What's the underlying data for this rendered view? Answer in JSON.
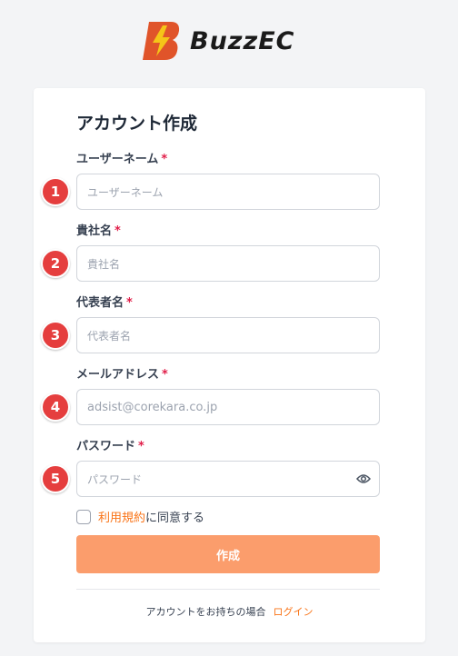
{
  "brand": {
    "name": "BuzzEC",
    "logo_color": "#e0542a",
    "bolt_color": "#f5c518"
  },
  "form": {
    "title": "アカウント作成",
    "required_mark": "*",
    "fields": [
      {
        "label": "ユーザーネーム",
        "placeholder": "ユーザーネーム",
        "badge": "1"
      },
      {
        "label": "貴社名",
        "placeholder": "貴社名",
        "badge": "2"
      },
      {
        "label": "代表者名",
        "placeholder": "代表者名",
        "badge": "3"
      },
      {
        "label": "メールアドレス",
        "placeholder": "adsist@corekara.co.jp",
        "badge": "4"
      },
      {
        "label": "パスワード",
        "placeholder": "パスワード",
        "badge": "5",
        "icon": "eye-icon"
      }
    ],
    "agree": {
      "link_text": "利用規約",
      "text": "に同意する"
    },
    "submit_label": "作成",
    "footer": {
      "text": "アカウントをお持ちの場合",
      "link_text": "ログイン"
    }
  },
  "colors": {
    "accent": "#f97316",
    "button": "#fb9d6c",
    "badge": "#e53e3e",
    "required": "#e11d48"
  }
}
